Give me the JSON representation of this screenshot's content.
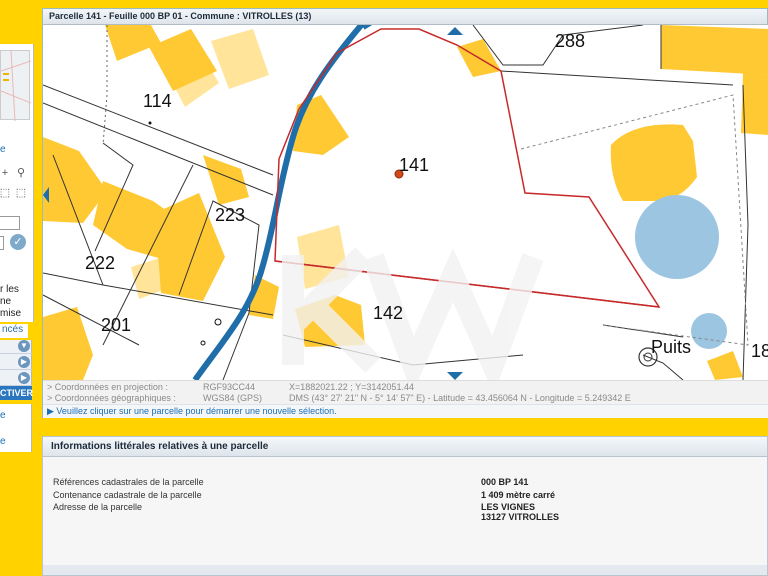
{
  "window": {
    "title": "Parcelle 141 - Feuille 000 BP 01 - Commune : VITROLLES (13)"
  },
  "map": {
    "parcels": [
      {
        "label": "288"
      },
      {
        "label": "114"
      },
      {
        "label": "141"
      },
      {
        "label": "223"
      },
      {
        "label": "222"
      },
      {
        "label": "142"
      },
      {
        "label": "201"
      },
      {
        "label": "18"
      }
    ],
    "place_label": "Puits",
    "colors": {
      "building": "#ffc933",
      "building_shadow": "#ffe49a",
      "road": "#1f6ea9",
      "selected_outline": "#c62a2a",
      "water": "#9cc5e1",
      "parcel_line": "#333333"
    }
  },
  "coordinates": {
    "projection_label": "> Coordonnées en projection :",
    "projection_system": "RGF93CC44",
    "projection_value": "X=1882021.22 ; Y=3142051.44",
    "geo_label": "> Coordonnées géographiques :",
    "geo_system": "WGS84 (GPS)",
    "geo_value": "DMS (43° 27' 21\" N - 5° 14' 57\" E) - Latitude = 43.456064 N - Longitude = 5.249342 E"
  },
  "hint": "▶ Veuillez cliquer sur une parcelle pour démarrer une nouvelle sélection.",
  "sidebar": {
    "link_fragment": "e",
    "text_lines": [
      "r les",
      "ne mise"
    ],
    "advanced_tab": "ncés",
    "activate_button": "CTIVER",
    "bottom_items": [
      "e",
      "e"
    ]
  },
  "info_panel": {
    "title": "Informations littérales relatives à une parcelle",
    "rows": [
      {
        "label": "Références cadastrales de la parcelle",
        "value": "000 BP 141"
      },
      {
        "label": "Contenance cadastrale de la parcelle",
        "value": "1 409 mètre carré"
      },
      {
        "label": "Adresse de la parcelle",
        "value": "LES VIGNES",
        "value2": "13127 VITROLLES"
      }
    ]
  }
}
